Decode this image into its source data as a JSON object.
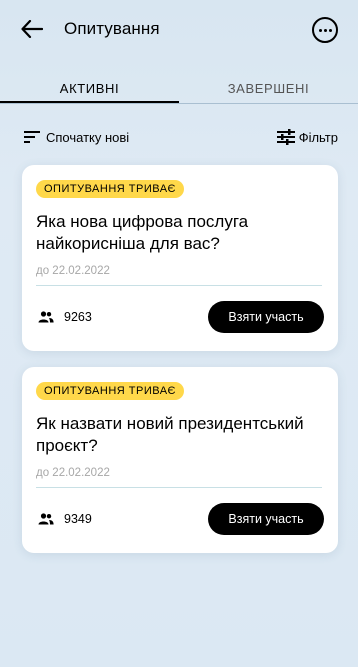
{
  "header": {
    "title": "Опитування"
  },
  "tabs": [
    {
      "label": "АКТИВНІ"
    },
    {
      "label": "ЗАВЕРШЕНІ"
    }
  ],
  "toolbar": {
    "sort_label": "Спочатку нові",
    "filter_label": "Фільтр"
  },
  "polls": [
    {
      "badge": "ОПИТУВАННЯ ТРИВАЄ",
      "question": "Яка нова цифрова послуга найкорисніша для вас?",
      "date": "до 22.02.2022",
      "participants": "9263",
      "button": "Взяти участь"
    },
    {
      "badge": "ОПИТУВАННЯ ТРИВАЄ",
      "question": "Як назвати новий президентський проєкт?",
      "date": "до 22.02.2022",
      "participants": "9349",
      "button": "Взяти участь"
    }
  ],
  "colors": {
    "badge": "#ffd84a",
    "background": "#dbe8f3",
    "button": "#000000"
  },
  "icons": {
    "back": "arrow-left-icon",
    "more": "more-dots-icon",
    "sort": "sort-lines-icon",
    "filter": "filter-sliders-icon",
    "people": "people-icon"
  }
}
